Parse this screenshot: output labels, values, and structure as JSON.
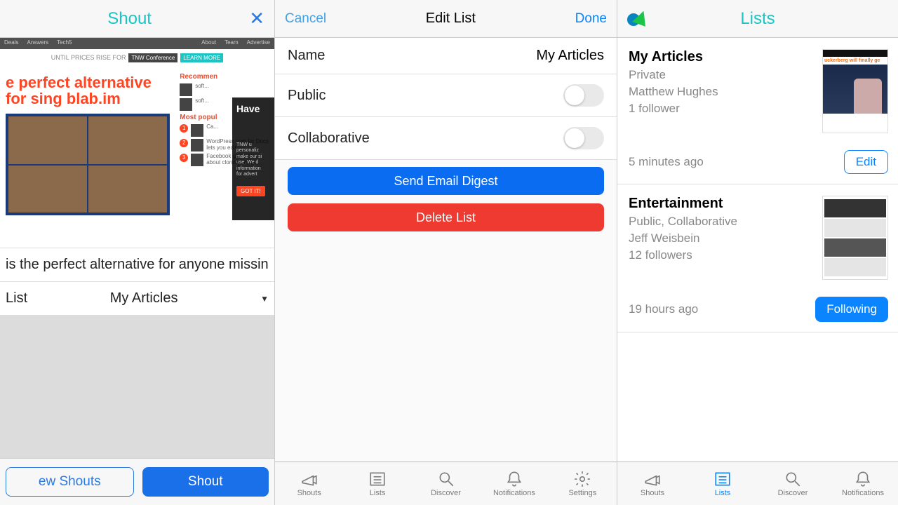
{
  "panel1": {
    "header_title": "Shout",
    "close_glyph": "✕",
    "preview": {
      "nav_items": [
        "Deals",
        "Answers",
        "Tech5"
      ],
      "nav_right": [
        "About",
        "Team",
        "Advertise"
      ],
      "banner_prefix": "UNTIL PRICES RISE FOR",
      "banner_tag": "TNW Conference",
      "banner_cta": "LEARN MORE",
      "headline": "e perfect alternative for sing blab.im",
      "rec_label": "Recommen",
      "pop_label": "Most popul",
      "overlay_title": "Have",
      "overlay_cta": "GOT IT!"
    },
    "article_title": "is the perfect alternative for anyone missin",
    "list_label": "List",
    "list_value": "My Articles",
    "btn_new": "ew Shouts",
    "btn_shout": "Shout"
  },
  "panel2": {
    "cancel": "Cancel",
    "title": "Edit List",
    "done": "Done",
    "name_label": "Name",
    "name_value": "My Articles",
    "public_label": "Public",
    "collab_label": "Collaborative",
    "send_digest": "Send Email Digest",
    "delete": "Delete List",
    "tabs": [
      "Shouts",
      "Lists",
      "Discover",
      "Notifications",
      "Settings"
    ]
  },
  "panel3": {
    "title": "Lists",
    "cards": [
      {
        "title": "My Articles",
        "visibility": "Private",
        "author": "Matthew Hughes",
        "followers": "1 follower",
        "time": "5 minutes ago",
        "action": "Edit",
        "thumb_headline": "uckerberg will finally ge"
      },
      {
        "title": "Entertainment",
        "visibility": "Public, Collaborative",
        "author": "Jeff Weisbein",
        "followers": "12 followers",
        "time": "19 hours ago",
        "action": "Following"
      }
    ],
    "tabs": [
      "Shouts",
      "Lists",
      "Discover",
      "Notifications"
    ]
  }
}
